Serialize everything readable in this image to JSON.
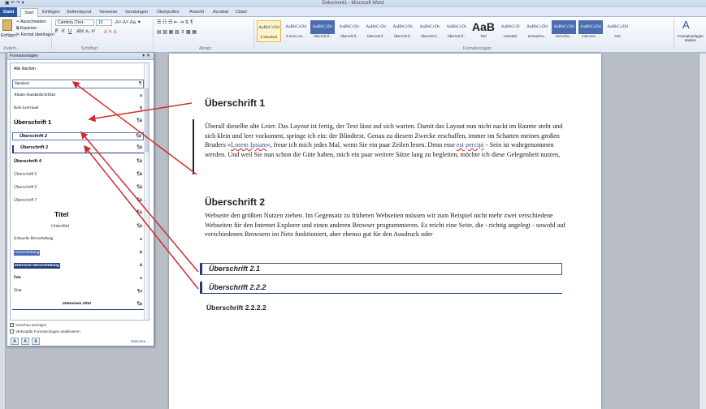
{
  "window": {
    "title": "Dokument1 - Microsoft Word",
    "quick_access": "▣ ↶ ↷ ▾"
  },
  "ribbon_tabs": [
    {
      "label": "Datei"
    },
    {
      "label": "Start"
    },
    {
      "label": "Einfügen"
    },
    {
      "label": "Seitenlayout"
    },
    {
      "label": "Verweise"
    },
    {
      "label": "Sendungen"
    },
    {
      "label": "Überprüfen"
    },
    {
      "label": "Ansicht"
    },
    {
      "label": "Acrobat"
    },
    {
      "label": "Citavi"
    }
  ],
  "ribbon": {
    "clipboard": {
      "paste": "Einfügen",
      "cut": "Ausschneiden",
      "copy": "Kopieren",
      "format_painter": "Format übertragen",
      "group": "Zwisch..."
    },
    "font": {
      "name": "Cambria (Text -",
      "size": "10",
      "group": "Schriftart"
    },
    "paragraph": {
      "group": "Absatz"
    },
    "styles": {
      "group": "Formatvorlagen",
      "change_styles": "Formatvorlagen ändern",
      "tiles": [
        {
          "preview": "AaBbCcDd",
          "name": "¶ Standard"
        },
        {
          "preview": "AaBbCcDd",
          "name": "¶ Kein Lee..."
        },
        {
          "preview": "AaBbCcDc",
          "name": "Überschrif..."
        },
        {
          "preview": "AaBbCcDc",
          "name": "Überschrif..."
        },
        {
          "preview": "AaBbCcDc",
          "name": "Überschrif..."
        },
        {
          "preview": "AaBbCcDc",
          "name": "Überschrif..."
        },
        {
          "preview": "AaBbCcDc",
          "name": "Überschrif..."
        },
        {
          "preview": "AaBbCcDc",
          "name": "Überschrif..."
        },
        {
          "preview": "AaB",
          "name": "Titel"
        },
        {
          "preview": "AaBbCcD",
          "name": "Untertitel"
        },
        {
          "preview": "AaBbCcDd",
          "name": "Schwache..."
        },
        {
          "preview": "AaBbCcDd",
          "name": "Hervorhe..."
        },
        {
          "preview": "AaBbCcDd",
          "name": "Intensive ..."
        },
        {
          "preview": "AaBbCcDd",
          "name": "Fett"
        }
      ]
    }
  },
  "styles_pane": {
    "title": "Formatvorlagen",
    "controls": "▾ ✕",
    "items": [
      {
        "label": "Alle löschen",
        "type": ""
      },
      {
        "label": "Standard",
        "type": "¶"
      },
      {
        "label": "Absatz-Standardschriftart",
        "type": "a"
      },
      {
        "label": "Kein Leerraum",
        "type": "¶"
      },
      {
        "label": "Überschrift 1",
        "type": "¶a"
      },
      {
        "label": "Überschrift 2",
        "type": "¶a"
      },
      {
        "label": "Überschrift 3",
        "type": "¶a"
      },
      {
        "label": "Überschrift 4",
        "type": "¶a"
      },
      {
        "label": "Überschrift 5",
        "type": "¶a"
      },
      {
        "label": "Überschrift 6",
        "type": "¶a"
      },
      {
        "label": "Überschrift 7",
        "type": "¶a"
      },
      {
        "label": "Titel",
        "type": "¶a"
      },
      {
        "label": "Untertitel",
        "type": "¶a"
      },
      {
        "label": "Schwache Hervorhebung",
        "type": "a"
      },
      {
        "label": "Hervorhebung",
        "type": "a"
      },
      {
        "label": "Intensive Hervorhebung",
        "type": "a"
      },
      {
        "label": "Fett",
        "type": "a"
      },
      {
        "label": "Zitat",
        "type": "¶a"
      },
      {
        "label": "Intensives Zitat",
        "type": "¶a"
      }
    ],
    "show_preview": "Vorschau anzeigen",
    "disable_linked": "Verknüpfte Formatvorlagen deaktivieren",
    "options": "Optionen..."
  },
  "document": {
    "heading1": "Überschrift 1",
    "para1_a": "Überall dieselbe alte Leier. Das Layout ist fertig, der Text lässt auf sich warten. Damit das Layout nun nicht nackt im Raume steht und sich klein und leer vorkommt, springe ich ein: der Blindtext. Genau zu diesem Zwecke erschaffen, immer im Schatten meines großen Bruders »",
    "para1_link": "Lorem Ipsum",
    "para1_b": "«, freue ich mich jedes Mal, wenn Sie ein paar Zeilen lesen. Denn esse ",
    "para1_link2": "est percipi",
    "para1_c": " - Sein ist wahrgenommen werden. Und weil Sie nun schon die Güte haben, mich ein paar weitere Sätze lang zu begleiten, möchte ich diese Gelegenheit nutzen,",
    "heading2": "Überschrift 2",
    "para2": "Webseite den größten Nutzen ziehen. Im Gegensatz zu früheren Webseiten müssen wir zum Beispiel nicht mehr zwei verschiedene Webseiten für den Internet Explorer und einen anderen Browser programmieren. Es reicht eine Seite, die - richtig angelegt - sowohl auf verschiedenen Browsern im Netz funktioniert, aber ebenso gut für den Ausdruck oder",
    "heading21": "Überschrift 2.1",
    "heading222": "Überschrift 2.2.2",
    "heading2222": "Überschrift 2.2.2.2"
  },
  "colors": {
    "accent": "#1f3e78",
    "arrow": "#d42b2b",
    "file_tab": "#2a5699"
  }
}
